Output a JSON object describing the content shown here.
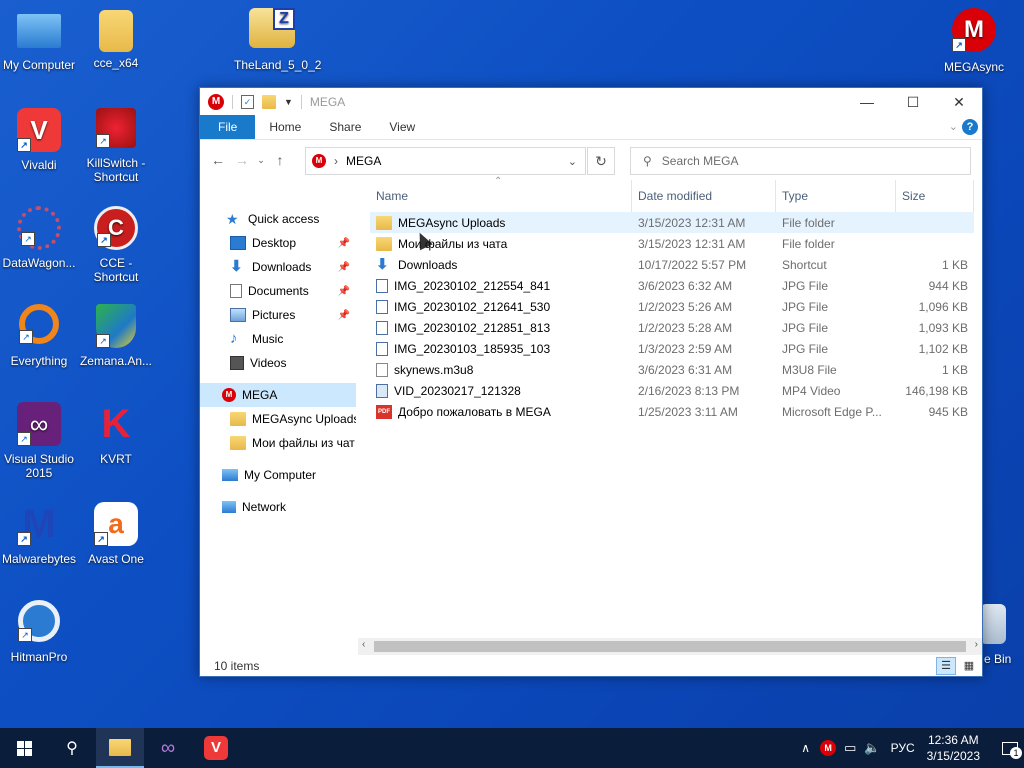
{
  "desktop": {
    "icons": [
      {
        "label": "My Computer"
      },
      {
        "label": "cce_x64"
      },
      {
        "label": "TheLand_5_0_2"
      },
      {
        "label": "MEGAsync"
      },
      {
        "label": "Vivaldi"
      },
      {
        "label": "KillSwitch - Shortcut"
      },
      {
        "label": "DataWagon..."
      },
      {
        "label": "CCE - Shortcut"
      },
      {
        "label": "Everything"
      },
      {
        "label": "Zemana.An..."
      },
      {
        "label": "Visual Studio 2015"
      },
      {
        "label": "KVRT"
      },
      {
        "label": "Malwarebytes"
      },
      {
        "label": "Avast One"
      },
      {
        "label": "HitmanPro"
      },
      {
        "label": "e Bin"
      }
    ]
  },
  "window": {
    "title": "MEGA",
    "ribbon_tabs": [
      "File",
      "Home",
      "Share",
      "View"
    ],
    "address": "MEGA",
    "search_placeholder": "Search MEGA",
    "status": "10 items"
  },
  "nav": {
    "quick_access": "Quick access",
    "pinned": [
      "Desktop",
      "Downloads",
      "Documents",
      "Pictures"
    ],
    "unpinned": [
      "Music",
      "Videos"
    ],
    "mega": "MEGA",
    "mega_children": [
      "MEGAsync Uploads",
      "Мои файлы из чат"
    ],
    "my_computer": "My Computer",
    "network": "Network"
  },
  "columns": {
    "name": "Name",
    "date": "Date modified",
    "type": "Type",
    "size": "Size"
  },
  "files": [
    {
      "name": "MEGAsync Uploads",
      "date": "3/15/2023 12:31 AM",
      "type": "File folder",
      "size": "",
      "icon": "folder-icon"
    },
    {
      "name": "Мои файлы из чата",
      "date": "3/15/2023 12:31 AM",
      "type": "File folder",
      "size": "",
      "icon": "folder-icon"
    },
    {
      "name": "Downloads",
      "date": "10/17/2022 5:57 PM",
      "type": "Shortcut",
      "size": "1 KB",
      "icon": "shortcut-icon"
    },
    {
      "name": "IMG_20230102_212554_841",
      "date": "3/6/2023 6:32 AM",
      "type": "JPG File",
      "size": "944 KB",
      "icon": "image-file-icon"
    },
    {
      "name": "IMG_20230102_212641_530",
      "date": "1/2/2023 5:26 AM",
      "type": "JPG File",
      "size": "1,096 KB",
      "icon": "image-file-icon"
    },
    {
      "name": "IMG_20230102_212851_813",
      "date": "1/2/2023 5:28 AM",
      "type": "JPG File",
      "size": "1,093 KB",
      "icon": "image-file-icon"
    },
    {
      "name": "IMG_20230103_185935_103",
      "date": "1/3/2023 2:59 AM",
      "type": "JPG File",
      "size": "1,102 KB",
      "icon": "image-file-icon"
    },
    {
      "name": "skynews.m3u8",
      "date": "3/6/2023 6:31 AM",
      "type": "M3U8 File",
      "size": "1 KB",
      "icon": "blank-file-icon"
    },
    {
      "name": "VID_20230217_121328",
      "date": "2/16/2023 8:13 PM",
      "type": "MP4 Video",
      "size": "146,198 KB",
      "icon": "video-file-icon"
    },
    {
      "name": "Добро пожаловать в MEGA",
      "date": "1/25/2023 3:11 AM",
      "type": "Microsoft Edge P...",
      "size": "945 KB",
      "icon": "pdf-file-icon"
    }
  ],
  "taskbar": {
    "lang": "РУС",
    "time": "12:36 AM",
    "date": "3/15/2023",
    "notif_count": "1"
  },
  "colors": {
    "accent": "#1979ca",
    "mega_red": "#d90007",
    "taskbar": "#0a1d3a"
  }
}
